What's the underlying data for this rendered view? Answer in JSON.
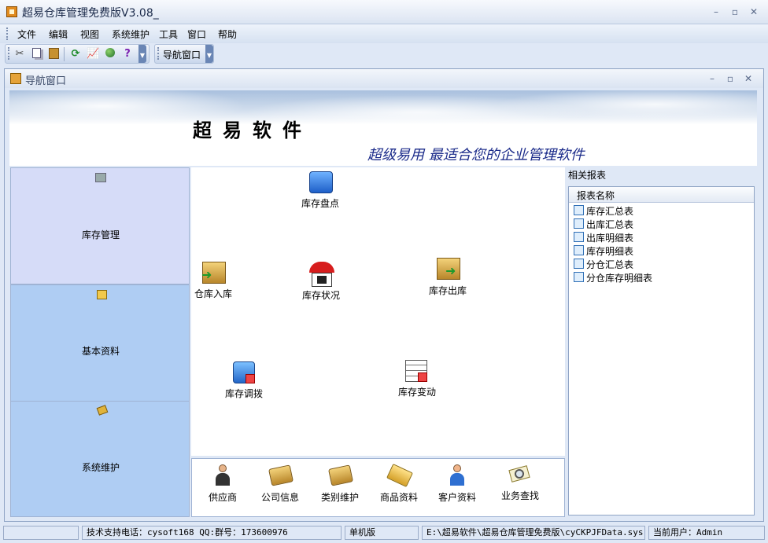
{
  "app": {
    "title": "超易仓库管理免费版V3.08_"
  },
  "menu": [
    {
      "label": "文件",
      "key": "F"
    },
    {
      "label": "编辑",
      "key": "E"
    },
    {
      "label": "视图",
      "key": "V"
    },
    {
      "label": "系统维护",
      "key": ""
    },
    {
      "label": "工具",
      "key": "T"
    },
    {
      "label": "窗口",
      "key": "W"
    },
    {
      "label": "帮助",
      "key": "H"
    }
  ],
  "toolbar": {
    "icons": [
      "cut-icon",
      "copy-icon",
      "paste-icon",
      "refresh-icon",
      "chart-icon",
      "globe-icon",
      "help-icon"
    ],
    "nav_label": "导航窗口"
  },
  "child_window": {
    "title": "导航窗口"
  },
  "banner": {
    "company": "超易软件",
    "slogan": "超级易用 最适合您的企业管理软件"
  },
  "left_panel": [
    {
      "label": "库存管理",
      "icon": "cart-icon",
      "selected": true
    },
    {
      "label": "基本资料",
      "icon": "folder-icon",
      "selected": false
    },
    {
      "label": "系统维护",
      "icon": "wrench-icon",
      "selected": false
    }
  ],
  "functions": {
    "stocktake": "库存盘点",
    "inbound": "仓库入库",
    "status": "库存状况",
    "outbound": "库存出库",
    "transfer": "库存调拨",
    "change": "库存变动"
  },
  "bottom": [
    "供应商",
    "公司信息",
    "类别维护",
    "商品资料",
    "客户资料",
    "业务查找"
  ],
  "reports": {
    "title": "相关报表",
    "column": "报表名称",
    "items": [
      "库存汇总表",
      "出库汇总表",
      "出库明细表",
      "库存明细表",
      "分仓汇总表",
      "分仓库存明细表"
    ]
  },
  "status": {
    "support": "技术支持电话：cysoft168 QQ:群号：173600976",
    "mode": "单机版",
    "path": "E:\\超易软件\\超易仓库管理免费版\\cyCKPJFData.sys",
    "user": "当前用户：Admin"
  },
  "colors": {
    "accent": "#dfe8f6",
    "selected_panel": "#d6dcf8",
    "panel": "#afcdf3",
    "slogan": "#1b2b8a"
  }
}
